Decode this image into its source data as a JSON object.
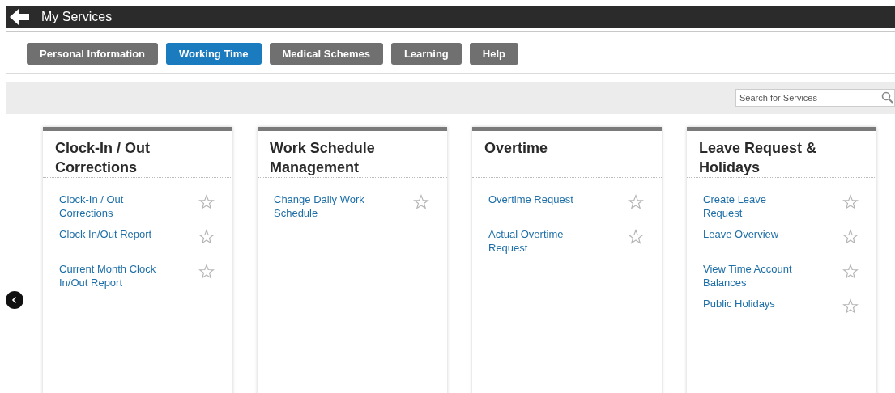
{
  "header": {
    "title": "My Services"
  },
  "tabs": [
    {
      "label": "Personal Information",
      "selected": false
    },
    {
      "label": "Working Time",
      "selected": true
    },
    {
      "label": "Medical Schemes",
      "selected": false
    },
    {
      "label": "Learning",
      "selected": false
    },
    {
      "label": "Help",
      "selected": false
    }
  ],
  "search": {
    "placeholder": "Search for Services"
  },
  "cards": [
    {
      "title": "Clock-In / Out Corrections",
      "items": [
        {
          "label": "Clock-In / Out Corrections",
          "favorite": false
        },
        {
          "label": "Clock In/Out Report",
          "favorite": false
        },
        {
          "label": "Current Month Clock In/Out Report",
          "favorite": false
        }
      ]
    },
    {
      "title": "Work Schedule Management",
      "items": [
        {
          "label": "Change Daily Work Schedule",
          "favorite": false
        }
      ]
    },
    {
      "title": "Overtime",
      "items": [
        {
          "label": "Overtime Request",
          "favorite": false
        },
        {
          "label": "Actual Overtime Request",
          "favorite": false
        }
      ]
    },
    {
      "title": "Leave Request & Holidays",
      "items": [
        {
          "label": "Create Leave Request",
          "favorite": false
        },
        {
          "label": "Leave Overview",
          "favorite": false
        },
        {
          "label": "View Time Account Balances",
          "favorite": false
        },
        {
          "label": "Public Holidays",
          "favorite": false
        }
      ]
    }
  ]
}
